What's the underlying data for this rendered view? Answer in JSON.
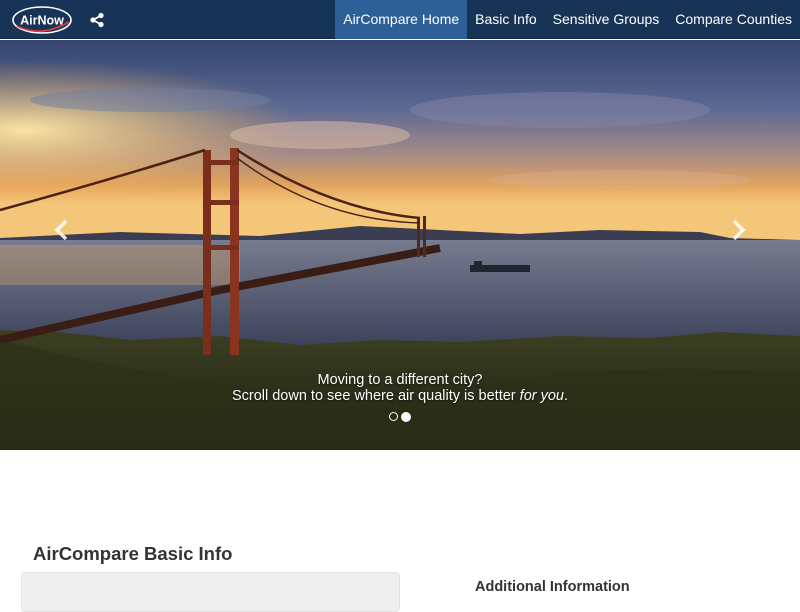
{
  "brand": {
    "logo_text": "AirNow"
  },
  "icons": {
    "share": "share-icon",
    "prev": "chevron-left-icon",
    "next": "chevron-right-icon"
  },
  "nav": {
    "items": [
      {
        "label": "AirCompare Home",
        "active": true
      },
      {
        "label": "Basic Info",
        "active": false
      },
      {
        "label": "Sensitive Groups",
        "active": false
      },
      {
        "label": "Compare Counties",
        "active": false
      }
    ]
  },
  "hero": {
    "caption_line1": "Moving to a different city?",
    "caption_line2_pre": "Scroll down to see where air quality is better ",
    "caption_line2_em": "for you",
    "caption_line2_post": ".",
    "slides_total": 2,
    "active_slide": 2
  },
  "content": {
    "section_title": "AirCompare Basic Info",
    "side_title": "Additional Information"
  },
  "colors": {
    "navbar": "#173456",
    "nav_active": "#2c6096",
    "text_dark": "#333333",
    "panel": "#efefef"
  }
}
